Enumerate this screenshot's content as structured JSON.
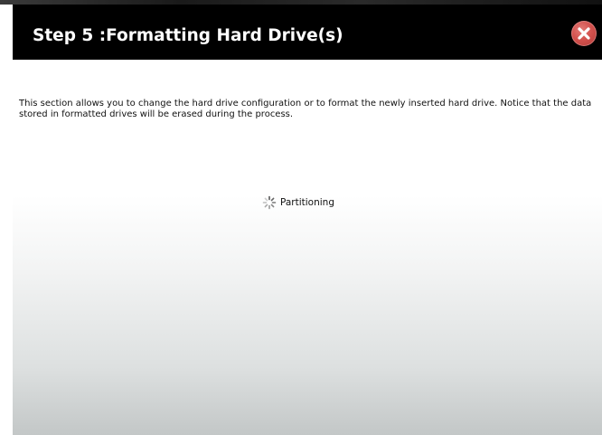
{
  "dialog": {
    "title": "Step 5 :Formatting Hard Drive(s)",
    "close_icon": "close-icon",
    "description": "This section allows you to change the hard drive configuration or to format the newly inserted hard drive. Notice that the data stored in formatted drives will be erased during the process.",
    "status": {
      "icon": "loading-spinner-icon",
      "text": "Partitioning"
    }
  },
  "colors": {
    "titlebar_bg": "#000000",
    "title_text": "#ffffff",
    "close_button": "#d3524e",
    "content_gradient_top": "#ffffff",
    "content_gradient_bottom": "#c3c7c7"
  }
}
